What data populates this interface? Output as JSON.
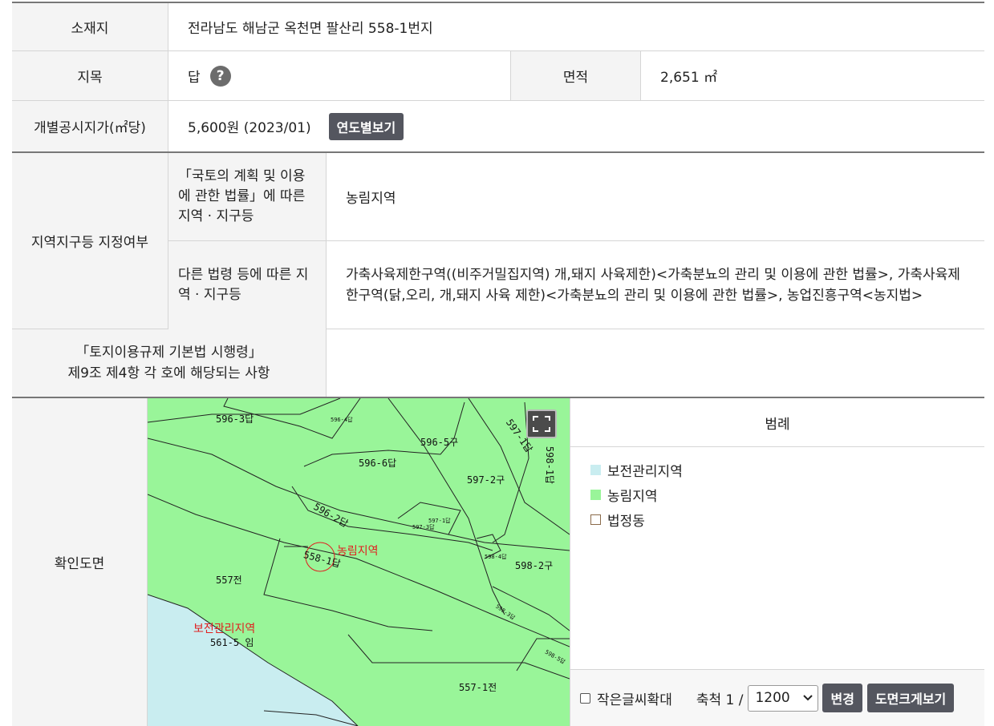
{
  "location": {
    "label": "소재지",
    "value": "전라남도 해남군 옥천면 팔산리 558-1번지"
  },
  "land_category": {
    "label": "지목",
    "value": "답",
    "help_icon": "question-icon",
    "help_glyph": "?"
  },
  "area": {
    "label": "면적",
    "value": "2,651 ㎡"
  },
  "official_price": {
    "label": "개별공시지가(㎡당)",
    "value": "5,600원 (2023/01)",
    "button": "연도별보기"
  },
  "zoning": {
    "label": "지역지구등 지정여부",
    "rows": [
      {
        "label": "「국토의 계획 및 이용에 관한 법률」에 따른 지역 · 지구등",
        "value": "농림지역"
      },
      {
        "label": "다른 법령 등에 따른 지역 · 지구등",
        "value": "가축사육제한구역((비주거밀집지역) 개,돼지 사육제한)<가축분뇨의 관리 및 이용에 관한 법률>, 가축사육제한구역(닭,오리, 개,돼지 사육 제한)<가축분뇨의 관리 및 이용에 관한 법률>, 농업진흥구역<농지법>"
      }
    ]
  },
  "enforcement": {
    "label_line1": "「토지이용규제 기본법 시행령」",
    "label_line2": "제9조 제4항 각 호에 해당되는 사항",
    "value": ""
  },
  "map_section": {
    "label": "확인도면",
    "fullscreen_icon": "fullscreen-icon",
    "parcel_labels": [
      "596-3답",
      "596-6답",
      "596-5구",
      "597-1답",
      "598-1답",
      "597-2구",
      "596-2답",
      "558-1답",
      "557전",
      "598-2구",
      "598-3답",
      "561-5 임",
      "557-1전",
      "596-4답",
      "597-1답",
      "598-4답",
      "598-5답",
      "597-3답"
    ],
    "zone_labels": [
      "농림지역",
      "보전관리지역"
    ],
    "legend": {
      "title": "범례",
      "items": [
        {
          "label": "보전관리지역",
          "color": "#c9edf0"
        },
        {
          "label": "농림지역",
          "color": "#99f599"
        },
        {
          "label": "법정동",
          "color": "#ffffff"
        }
      ]
    },
    "controls": {
      "checkbox_label": "작은글씨확대",
      "scale_label": "축척 1 /",
      "scale_value": "1200",
      "change_button": "변경",
      "enlarge_button": "도면크게보기"
    }
  }
}
